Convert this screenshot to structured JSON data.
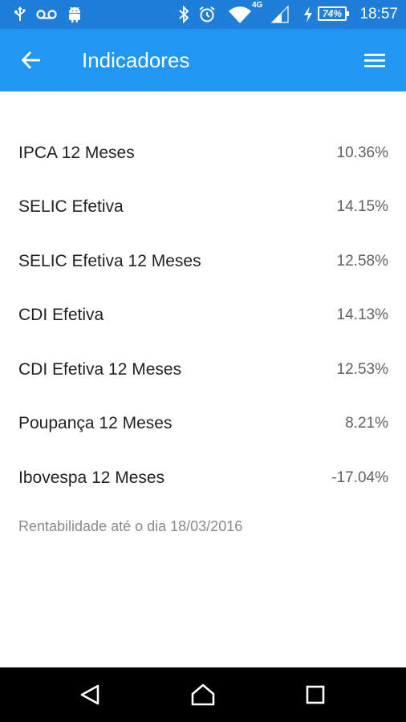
{
  "status_bar": {
    "time": "18:57",
    "battery": "74%",
    "network": "4G",
    "icons": [
      "usb-icon",
      "voicemail-icon",
      "android-icon",
      "bluetooth-icon",
      "alarm-icon",
      "wifi-icon",
      "signal-icon",
      "charging-icon",
      "battery-icon"
    ]
  },
  "app_bar": {
    "title": "Indicadores",
    "back_icon": "arrow-back-icon",
    "menu_icon": "hamburger-menu-icon",
    "color": "#2196f3"
  },
  "indicators": [
    {
      "name": "IPCA 12 Meses",
      "value": "10.36%"
    },
    {
      "name": "SELIC Efetiva",
      "value": "14.15%"
    },
    {
      "name": "SELIC Efetiva 12 Meses",
      "value": "12.58%"
    },
    {
      "name": "CDI Efetiva",
      "value": "14.13%"
    },
    {
      "name": "CDI Efetiva 12 Meses",
      "value": "12.53%"
    },
    {
      "name": "Poupança 12 Meses",
      "value": "8.21%"
    },
    {
      "name": "Ibovespa 12 Meses",
      "value": "-17.04%"
    }
  ],
  "footnote": "Rentabilidade até o dia 18/03/2016",
  "nav_bar": {
    "icons": [
      "back-triangle-icon",
      "home-icon",
      "recents-square-icon"
    ]
  }
}
